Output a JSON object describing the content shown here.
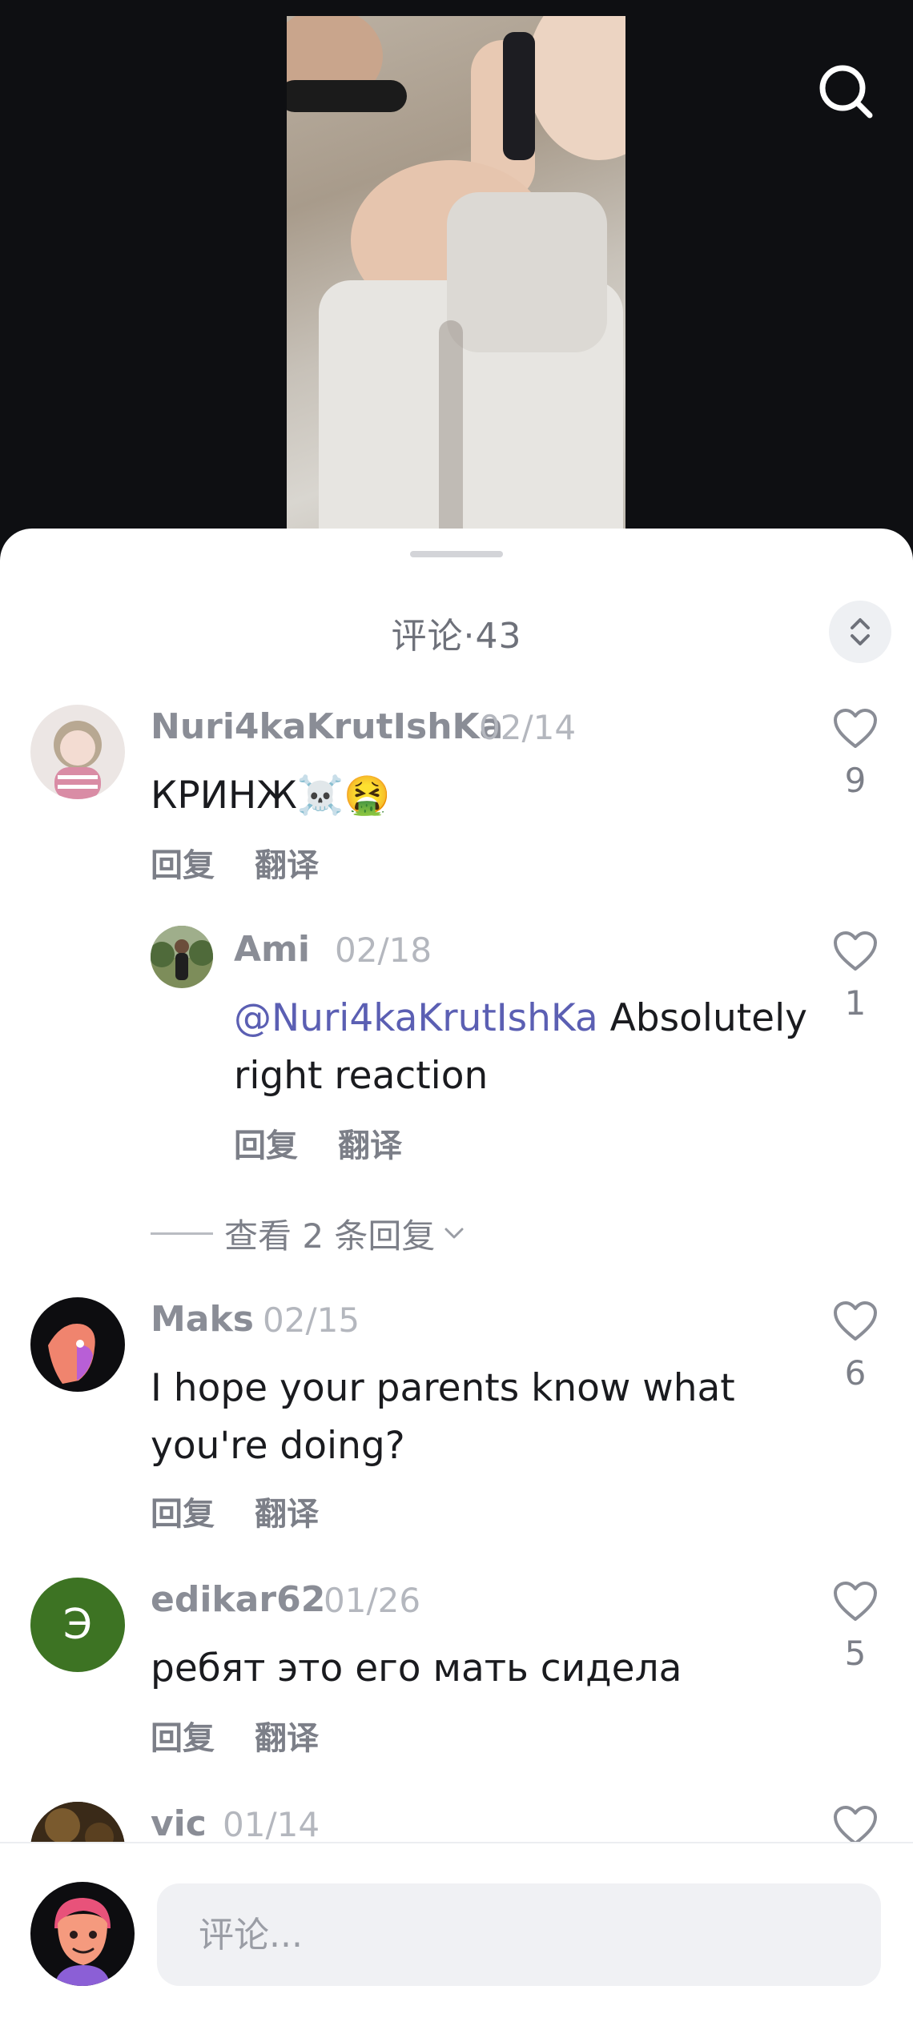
{
  "header": {
    "search_icon": "search-icon"
  },
  "sheet": {
    "title": "评论·43",
    "expand_icon": "chevron-up-down-icon"
  },
  "comments": [
    {
      "username": "Nuri4kaKrutIshKa",
      "date": "02/14",
      "text": "КРИНЖ☠️🤮",
      "reply_label": "回复",
      "translate_label": "翻译",
      "likes": "9"
    },
    {
      "username": "Ami",
      "date": "02/18",
      "mention": "@Nuri4kaKrutIshKa",
      "text_line1": " Absolutely",
      "text_line2": "right reaction",
      "reply_label": "回复",
      "translate_label": "翻译",
      "likes": "1"
    },
    {
      "username": "Maks",
      "date": "02/15",
      "text_line1": "I hope your parents know what",
      "text_line2": "you're doing?",
      "reply_label": "回复",
      "translate_label": "翻译",
      "likes": "6"
    },
    {
      "username": "edikar62",
      "date": "01/26",
      "avatar_letter": "Э",
      "text": "ребят это его мать сидела",
      "reply_label": "回复",
      "translate_label": "翻译",
      "likes": "5"
    },
    {
      "username": "vic",
      "date": "01/14"
    }
  ],
  "view_replies": {
    "label": "查看 2 条回复"
  },
  "composer": {
    "placeholder": "评论..."
  },
  "colors": {
    "mention": "#5b5fb3",
    "sheet_bg": "#ffffff",
    "video_bg": "#0e0f12",
    "avatar_green": "#3d7323"
  }
}
